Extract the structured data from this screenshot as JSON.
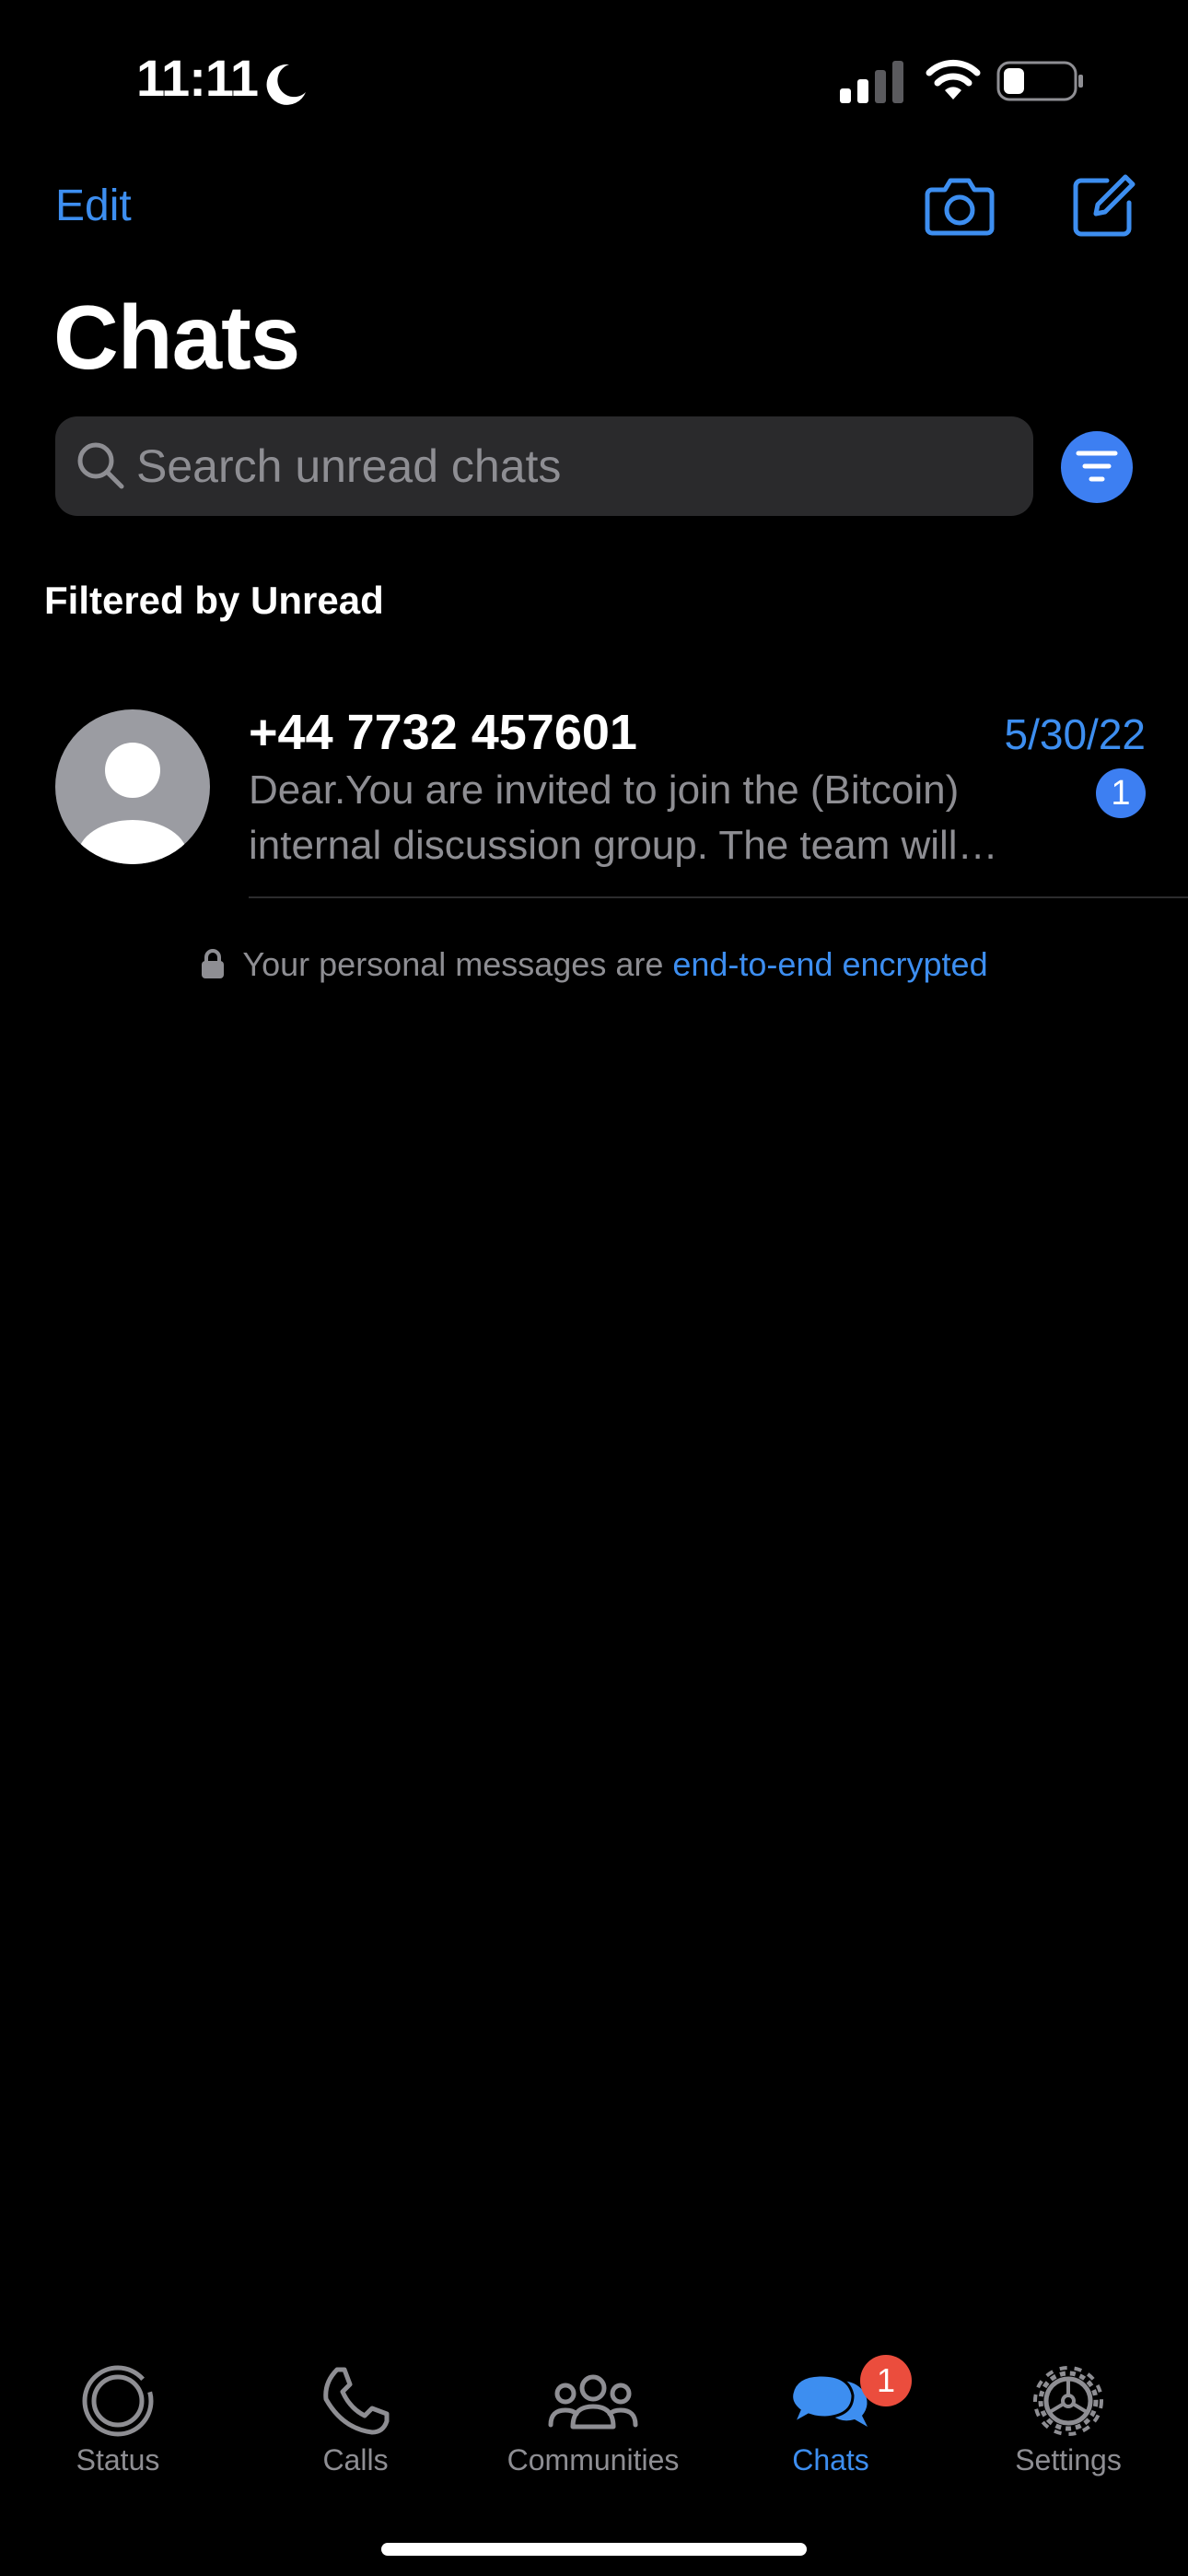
{
  "status_bar": {
    "time": "11:11"
  },
  "header": {
    "edit_label": "Edit",
    "title": "Chats",
    "camera_icon": "camera-icon",
    "compose_icon": "compose-icon"
  },
  "search": {
    "placeholder": "Search unread chats"
  },
  "filter_label": "Filtered by Unread",
  "chats": [
    {
      "name": "+44 7732 457601",
      "date": "5/30/22",
      "preview": "Dear.You are invited to join the  (Bitcoin) internal discussion group.  The team will…",
      "unread_count": "1"
    }
  ],
  "encryption_note": {
    "text": "Your personal messages are ",
    "link": "end-to-end encrypted"
  },
  "tabs": [
    {
      "label": "Status",
      "icon": "status-icon"
    },
    {
      "label": "Calls",
      "icon": "phone-icon"
    },
    {
      "label": "Communities",
      "icon": "communities-icon"
    },
    {
      "label": "Chats",
      "icon": "chats-icon",
      "badge": "1",
      "active": true
    },
    {
      "label": "Settings",
      "icon": "settings-icon"
    }
  ],
  "colors": {
    "accent": "#3d8ef0",
    "badge_red": "#eb4d3d",
    "background": "#000000",
    "secondary_text": "#8e8e93"
  }
}
